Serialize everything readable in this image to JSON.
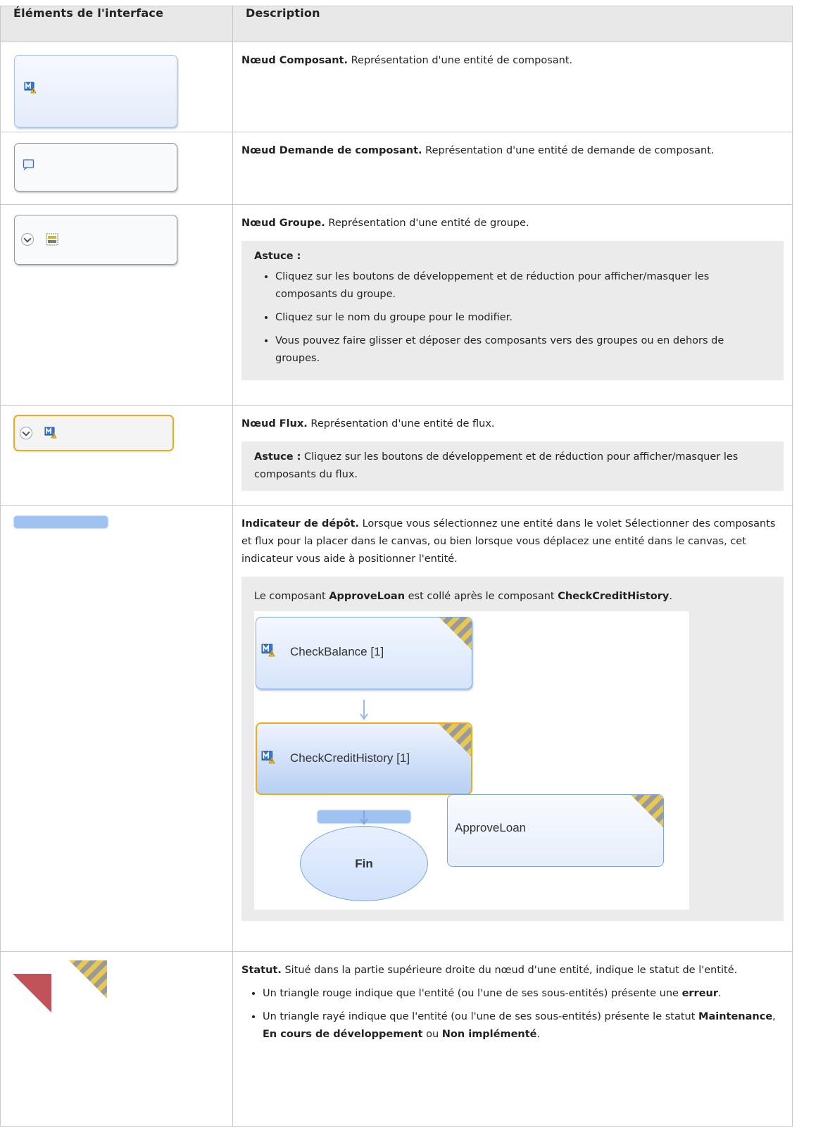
{
  "table": {
    "headers": [
      "Éléments de l'interface",
      "Description"
    ]
  },
  "rows": {
    "component": {
      "title": "Nœud Composant.",
      "text": " Représentation d'une entité de composant."
    },
    "request": {
      "title": "Nœud Demande de composant.",
      "text": " Représentation d'une entité de demande de composant."
    },
    "group": {
      "title": "Nœud Groupe.",
      "text": " Représentation d'une entité de groupe.",
      "tip_label": "Astuce :",
      "tips": [
        "Cliquez sur les boutons de développement et de réduction pour afficher/masquer les composants du groupe.",
        "Cliquez sur le nom du groupe pour le modifier.",
        "Vous pouvez faire glisser et déposer des composants vers des groupes ou en dehors de groupes."
      ]
    },
    "flow": {
      "title": "Nœud Flux.",
      "text": " Représentation d'une entité de flux.",
      "tip_label": "Astuce :",
      "tip_text": " Cliquez sur les boutons de développement et de réduction pour afficher/masquer les composants du flux."
    },
    "drop": {
      "title": "Indicateur de dépôt.",
      "text": " Lorsque vous sélectionnez une entité dans le volet Sélectionner des composants et flux pour la placer dans le canvas, ou bien lorsque vous déplacez une entité dans le canvas, cet indicateur vous aide à positionner l'entité.",
      "example": {
        "t1": "Le composant ",
        "b1": "ApproveLoan",
        "t2": " est collé après le composant ",
        "b2": "CheckCreditHistory",
        "t3": ".",
        "nodes": [
          "CheckBalance [1]",
          "CheckCreditHistory [1]",
          "ApproveLoan"
        ],
        "end_label": "Fin"
      }
    },
    "status": {
      "title": "Statut.",
      "text": " Situé dans la partie supérieure droite du nœud d'une entité, indique le statut de l'entité.",
      "bullet1": {
        "text": "Un triangle rouge indique que l'entité (ou l'une de ses sous-entités) présente une ",
        "bold": "erreur",
        "end": "."
      },
      "bullet2": {
        "text": "Un triangle rayé indique que l'entité (ou l'une de ses sous-entités) présente le statut ",
        "b1": "Maintenance",
        "sep1": ", ",
        "b2": "En cours de développement",
        "sep2": " ou ",
        "b3": "Non implémenté",
        "end": "."
      }
    }
  },
  "colors": {
    "node_border_blue": "#a9c2e8",
    "flow_border_orange": "#f2a91c",
    "drop_indicator": "#9ec2f2",
    "error_red": "#c0525a",
    "stripe_yellow": "#e8c850",
    "stripe_grey": "#9a9a9a",
    "header_bg": "#e8e8e8",
    "tip_bg": "#ebebeb"
  }
}
